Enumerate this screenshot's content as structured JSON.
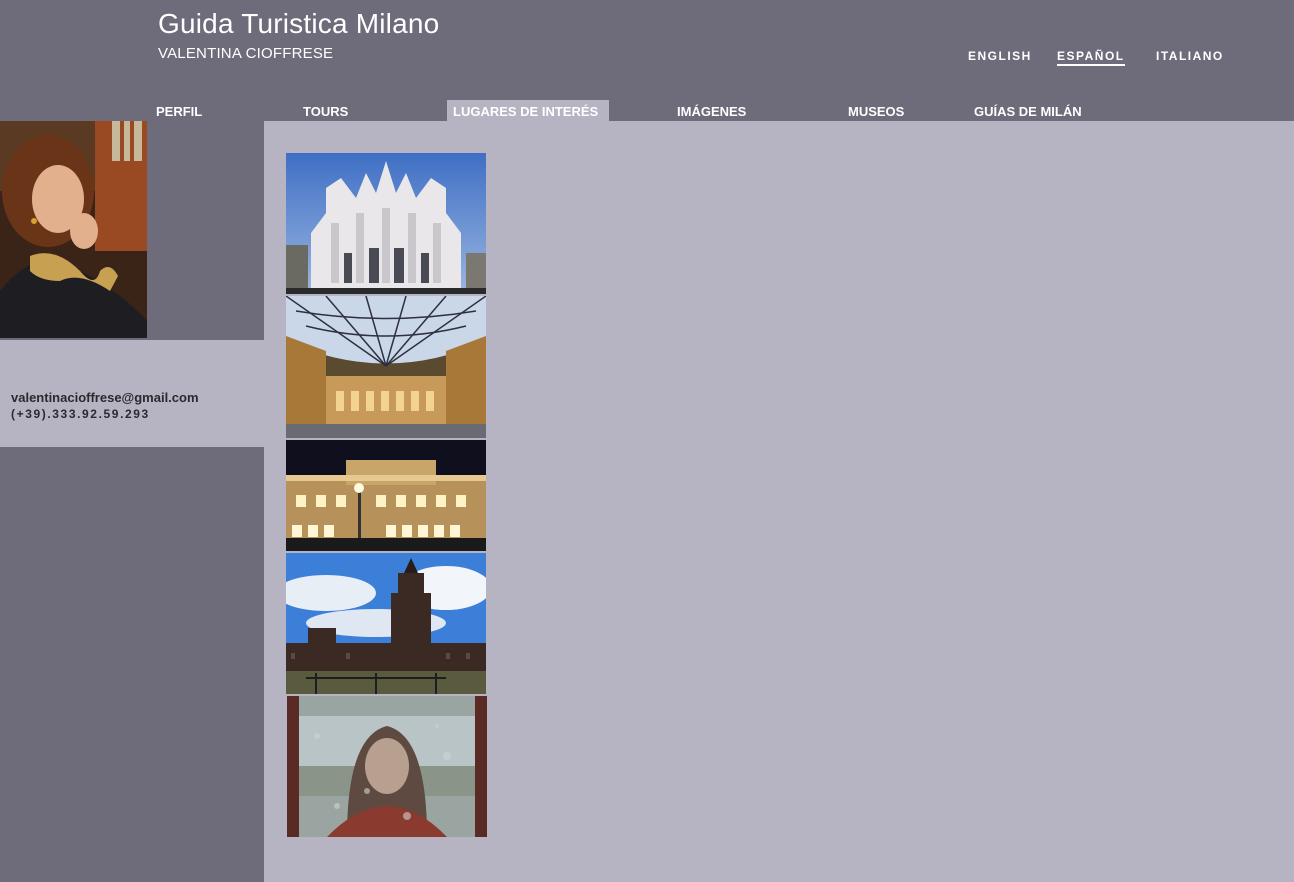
{
  "header": {
    "title": "Guida Turistica Milano",
    "subtitle": "VALENTINA CIOFFRESE"
  },
  "languages": [
    {
      "label": "ENGLISH",
      "active": false
    },
    {
      "label": "ESPAÑOL",
      "active": true
    },
    {
      "label": "ITALIANO",
      "active": false
    }
  ],
  "nav": [
    {
      "label": "PERFIL",
      "active": false
    },
    {
      "label": "TOURS",
      "active": false
    },
    {
      "label": "LUGARES DE INTERÉS",
      "active": true
    },
    {
      "label": "IMÁGENES",
      "active": false
    },
    {
      "label": "MUSEOS",
      "active": false
    },
    {
      "label": "GUÍAS DE MILÁN",
      "active": false
    }
  ],
  "contact": {
    "email": "valentinacioffrese@gmail.com",
    "phone": "(+39).333.92.59.293"
  },
  "gallery_images": [
    "duomo-image",
    "galleria-image",
    "scala-theatre-image",
    "sforza-castle-image",
    "fresco-image"
  ],
  "colors": {
    "header_bg": "#6e6b7a",
    "content_bg": "#b6b4c3",
    "text_light": "#ffffff",
    "text_dark": "#2a2a2e"
  }
}
